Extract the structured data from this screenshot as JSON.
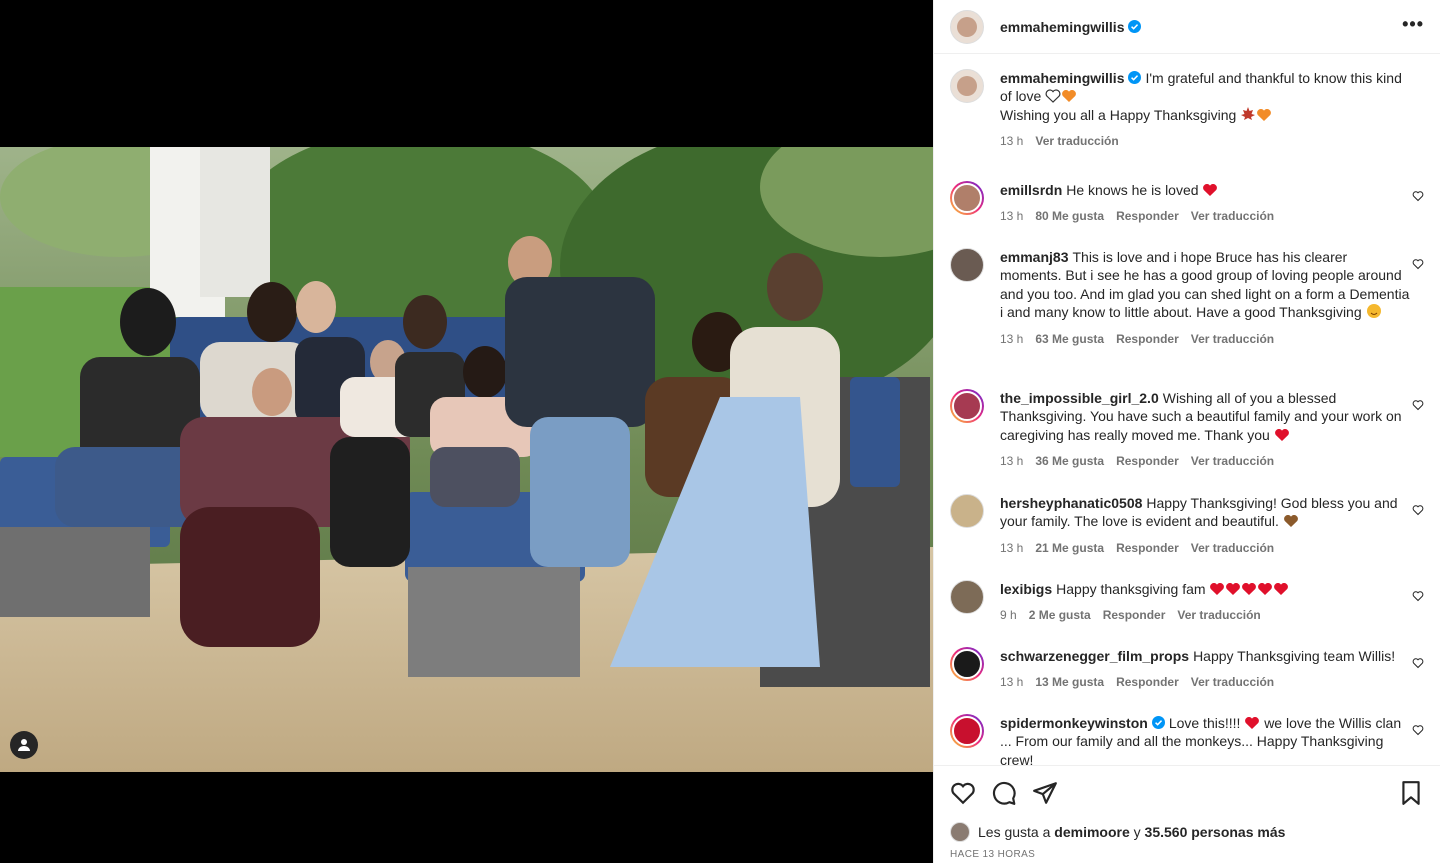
{
  "post": {
    "username": "emmahemingwillis",
    "caption_line1": "I'm grateful and thankful to know this kind of love",
    "caption_line2": "Wishing you all a Happy Thanksgiving",
    "caption_time": "13 h",
    "caption_translate": "Ver traducción"
  },
  "comments": [
    {
      "user": "emillsrdn",
      "text": "He knows he is loved",
      "time": "13 h",
      "likes": "80 Me gusta",
      "reply": "Responder",
      "translate": "Ver traducción"
    },
    {
      "user": "emmanj83",
      "text": "This is love and i hope Bruce has his clearer moments. But i see he has a good group of loving people around and you too. And im glad you can shed light on a form a Dementia i and many know to little about. Have a good Thanksgiving",
      "time": "13 h",
      "likes": "63 Me gusta",
      "reply": "Responder",
      "translate": "Ver traducción"
    },
    {
      "user": "the_impossible_girl_2.0",
      "text": "Wishing all of you a blessed Thanksgiving. You have such a beautiful family and your work on caregiving has really moved me. Thank you",
      "time": "13 h",
      "likes": "36 Me gusta",
      "reply": "Responder",
      "translate": "Ver traducción"
    },
    {
      "user": "hersheyphanatic0508",
      "text": "Happy Thanksgiving! God bless you and your family. The love is evident and beautiful.",
      "time": "13 h",
      "likes": "21 Me gusta",
      "reply": "Responder",
      "translate": "Ver traducción"
    },
    {
      "user": "lexibigs",
      "text": "Happy thanksgiving fam",
      "time": "9 h",
      "likes": "2 Me gusta",
      "reply": "Responder",
      "translate": "Ver traducción"
    },
    {
      "user": "schwarzenegger_film_props",
      "text": "Happy Thanksgiving team Willis!",
      "time": "13 h",
      "likes": "13 Me gusta",
      "reply": "Responder",
      "translate": "Ver traducción"
    },
    {
      "user": "spidermonkeywinston",
      "text_a": "Love this!!!!",
      "text_b": "we love the Willis clan ... From our family and all the monkeys... Happy Thanksgiving crew!"
    }
  ],
  "likes_line": {
    "prefix": "Les gusta a",
    "user": "demimoore",
    "conj": "y",
    "count": "35.560 personas más"
  },
  "timestamp": "HACE 13 HORAS",
  "colors": {
    "verified": "#0095f6",
    "heart_red": "#ed4956",
    "muted": "#737373"
  }
}
